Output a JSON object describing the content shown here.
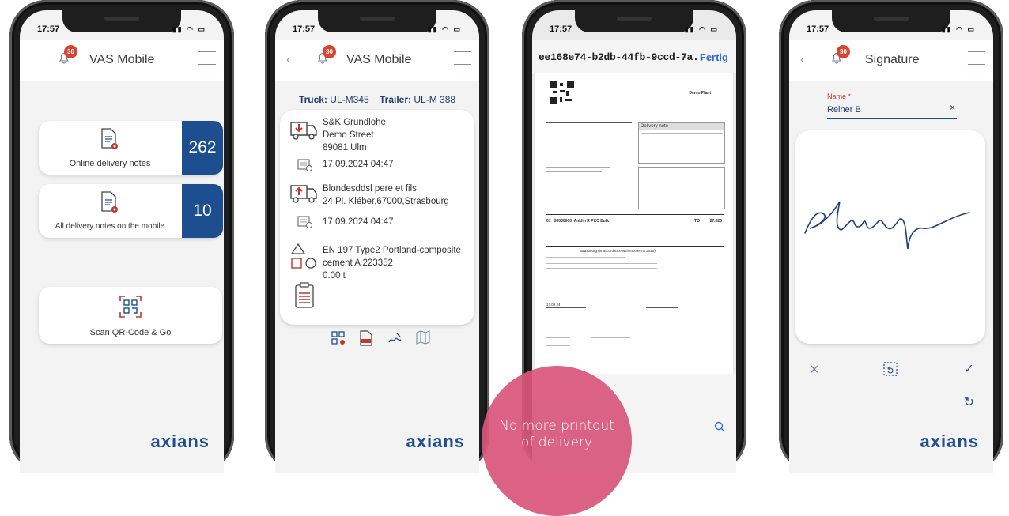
{
  "phone1": {
    "time": "17:57",
    "badge": "36",
    "title": "VAS Mobile",
    "tiles": [
      {
        "label": "Online delivery notes",
        "count": "262"
      },
      {
        "label": "All delivery notes on the mobile",
        "count": "10"
      }
    ],
    "scan_label": "Scan QR-Code & Go",
    "logo": "axians"
  },
  "phone2": {
    "time": "17:57",
    "badge": "30",
    "title": "VAS Mobile",
    "truck_label": "Truck:",
    "truck_value": "UL-M345",
    "trailer_label": "Trailer:",
    "trailer_value": "UL-M 388",
    "sender": [
      "S&K Grundlohe",
      "Demo Street",
      "89081 Ulm"
    ],
    "date1": "17.09.2024 04:47",
    "receiver": [
      "Blondesddsl pere et fils",
      "24 Pl. Kléber,67000,Strasbourg"
    ],
    "date2": "17.09.2024 04:47",
    "material": [
      "EN 197 Type2 Portland-composite",
      "cement A 223352",
      "0.00 t"
    ],
    "logo": "axians"
  },
  "phone3": {
    "time": "17:57",
    "doc_title": "ee168e74-b2db-44fb-9ccd-7a...",
    "done_label": "Fertig",
    "company": "Demo Plant",
    "delivery_note_heading": "Delivery note",
    "material_row": {
      "num": "01",
      "code": "50000000",
      "name": "Anklin R PCC Bulk",
      "unit": "TO",
      "qty": "27.020"
    },
    "terms": "Strasbourg (in accordance with Incoterms 2010)",
    "gross_date": "17.09.24"
  },
  "phone4": {
    "time": "17:57",
    "badge": "30",
    "title": "Signature",
    "name_label": "Name *",
    "name_value": "Reiner B",
    "logo": "axians"
  },
  "promo": {
    "lines": [
      "No more printout",
      "of delivery"
    ]
  },
  "colors": {
    "brand_blue": "#1d4e8f",
    "badge_red": "#d9432f",
    "promo_pink": "#d9577c"
  }
}
